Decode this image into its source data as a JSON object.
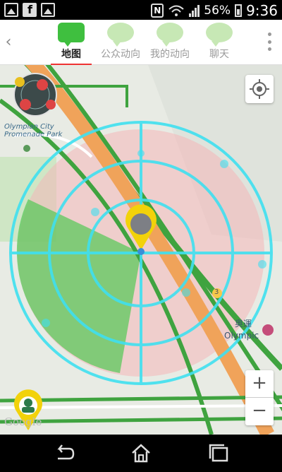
{
  "status_bar": {
    "battery": "56%",
    "time": "9:36",
    "icons": [
      "gallery-icon",
      "facebook-icon",
      "nfc-icon",
      "wifi-icon",
      "signal-icon",
      "battery-icon"
    ]
  },
  "nav": {
    "back_icon": "back-arrow-icon",
    "tabs": [
      {
        "label": "地图",
        "active": true
      },
      {
        "label": "公众动向",
        "active": false
      },
      {
        "label": "我的动向",
        "active": false
      },
      {
        "label": "聊天",
        "active": false
      }
    ],
    "more_icon": "overflow-menu-icon"
  },
  "map": {
    "place_label": "Olympian City Promenade Park",
    "place_line1": "Olympian City",
    "place_line2": "Promenade Park",
    "station_cn": "奥運",
    "station_en": "Olympic",
    "route_number": "3",
    "attribution": "Google",
    "zoom_in": "+",
    "zoom_out": "−",
    "locate_icon": "my-location-icon",
    "colors": {
      "radar": "#3fe0f0",
      "highway": "#f0a35a",
      "road": "#3fa33f",
      "zone_red": "#f4b6b8",
      "zone_green": "#5cc85c"
    }
  },
  "system_nav": {
    "back_icon": "back-icon",
    "home_icon": "home-icon",
    "recents_icon": "recents-icon"
  }
}
